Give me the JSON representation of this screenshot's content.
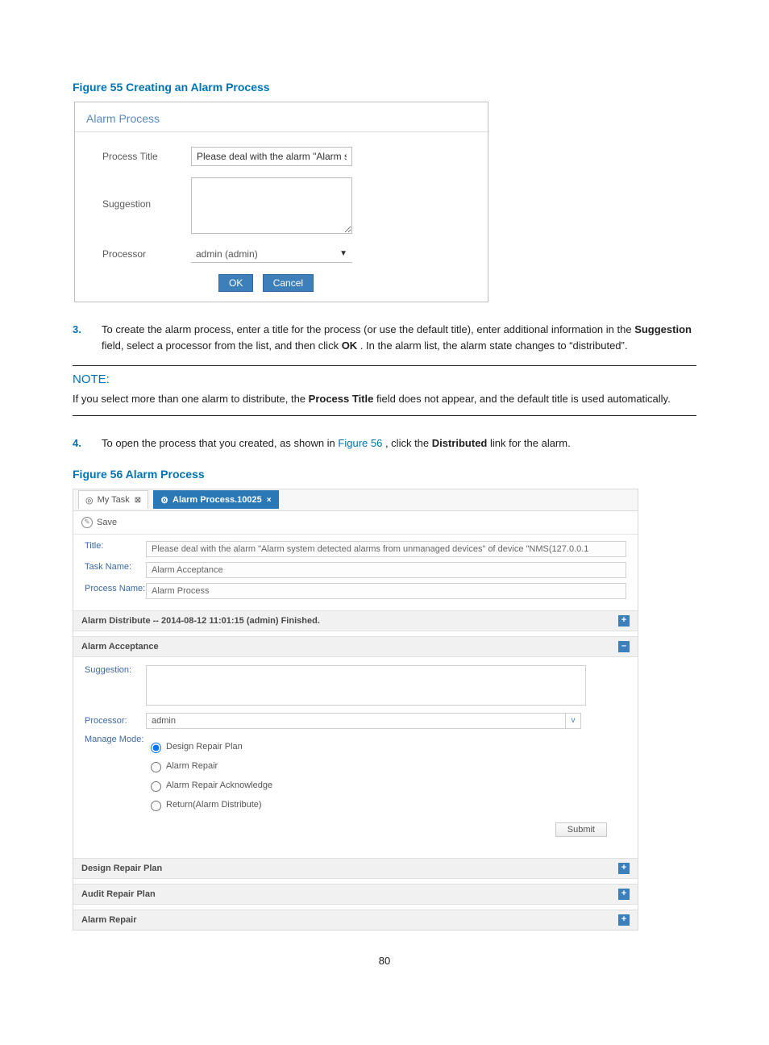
{
  "figure55": {
    "caption": "Figure 55 Creating an Alarm Process",
    "dialog_title": "Alarm Process",
    "labels": {
      "process_title": "Process Title",
      "suggestion": "Suggestion",
      "processor": "Processor"
    },
    "values": {
      "process_title": "Please deal with the alarm \"Alarm sy",
      "processor": "admin (admin)"
    },
    "buttons": {
      "ok": "OK",
      "cancel": "Cancel"
    }
  },
  "step3": {
    "num": "3.",
    "before_bold1": "To create the alarm process, enter a title for the process (or use the default title), enter additional information in the ",
    "bold1": "Suggestion",
    "mid": " field, select a processor from the list, and then click ",
    "bold2": "OK",
    "after": ". In the alarm list, the alarm state changes to “distributed”."
  },
  "note": {
    "head": "NOTE:",
    "before_bold": "If you select more than one alarm to distribute, the ",
    "bold": "Process Title",
    "after": " field does not appear, and the default title is used automatically."
  },
  "step4": {
    "num": "4.",
    "before_link": "To open the process that you created, as shown in ",
    "link": "Figure 56",
    "after_link_before_bold": ", click the ",
    "bold": "Distributed",
    "after_bold": " link for the alarm."
  },
  "figure56": {
    "caption": "Figure 56 Alarm Process",
    "tabs": {
      "mytask": "My Task",
      "active": "Alarm Process.10025"
    },
    "toolbar": {
      "save": "Save"
    },
    "form": {
      "title_label": "Title:",
      "title_value": "Please deal with the alarm \"Alarm system detected alarms from unmanaged devices\" of device \"NMS(127.0.0.1",
      "taskname_label": "Task Name:",
      "taskname_value": "Alarm Acceptance",
      "procname_label": "Process Name:",
      "procname_value": "Alarm Process"
    },
    "sections": {
      "distribute": "Alarm Distribute -- 2014-08-12 11:01:15 (admin) Finished.",
      "acceptance": "Alarm Acceptance",
      "design": "Design Repair Plan",
      "audit": "Audit Repair Plan",
      "repair": "Alarm Repair"
    },
    "acceptance_body": {
      "suggestion_label": "Suggestion:",
      "processor_label": "Processor:",
      "processor_value": "admin",
      "manage_label": "Manage Mode:",
      "radios": {
        "r1": "Design Repair Plan",
        "r2": "Alarm Repair",
        "r3": "Alarm Repair Acknowledge",
        "r4": "Return(Alarm Distribute)"
      },
      "submit": "Submit"
    },
    "toggle_minus": "–",
    "toggle_plus": "+"
  },
  "page_number": "80"
}
